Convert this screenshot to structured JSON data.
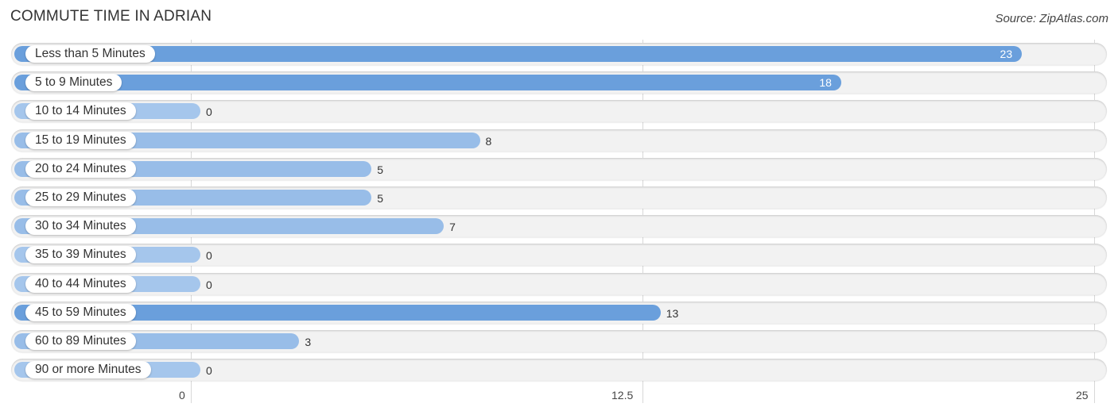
{
  "header": {
    "title": "COMMUTE TIME IN ADRIAN",
    "source": "Source: ZipAtlas.com"
  },
  "colors": {
    "bar_strong": "#6a9fdc",
    "bar_light": "#a5c6ec",
    "track": "#f2f2f2"
  },
  "chart_data": {
    "type": "bar",
    "orientation": "horizontal",
    "title": "COMMUTE TIME IN ADRIAN",
    "xlabel": "",
    "ylabel": "",
    "categories": [
      "Less than 5 Minutes",
      "5 to 9 Minutes",
      "10 to 14 Minutes",
      "15 to 19 Minutes",
      "20 to 24 Minutes",
      "25 to 29 Minutes",
      "30 to 34 Minutes",
      "35 to 39 Minutes",
      "40 to 44 Minutes",
      "45 to 59 Minutes",
      "60 to 89 Minutes",
      "90 or more Minutes"
    ],
    "values": [
      23,
      18,
      0,
      8,
      5,
      5,
      7,
      0,
      0,
      13,
      3,
      0
    ],
    "xlim": [
      0,
      25
    ],
    "xticks": [
      "0",
      "12.5",
      "25"
    ],
    "xtick_values": [
      0,
      12.5,
      25
    ],
    "grid": true,
    "legend": "none"
  }
}
